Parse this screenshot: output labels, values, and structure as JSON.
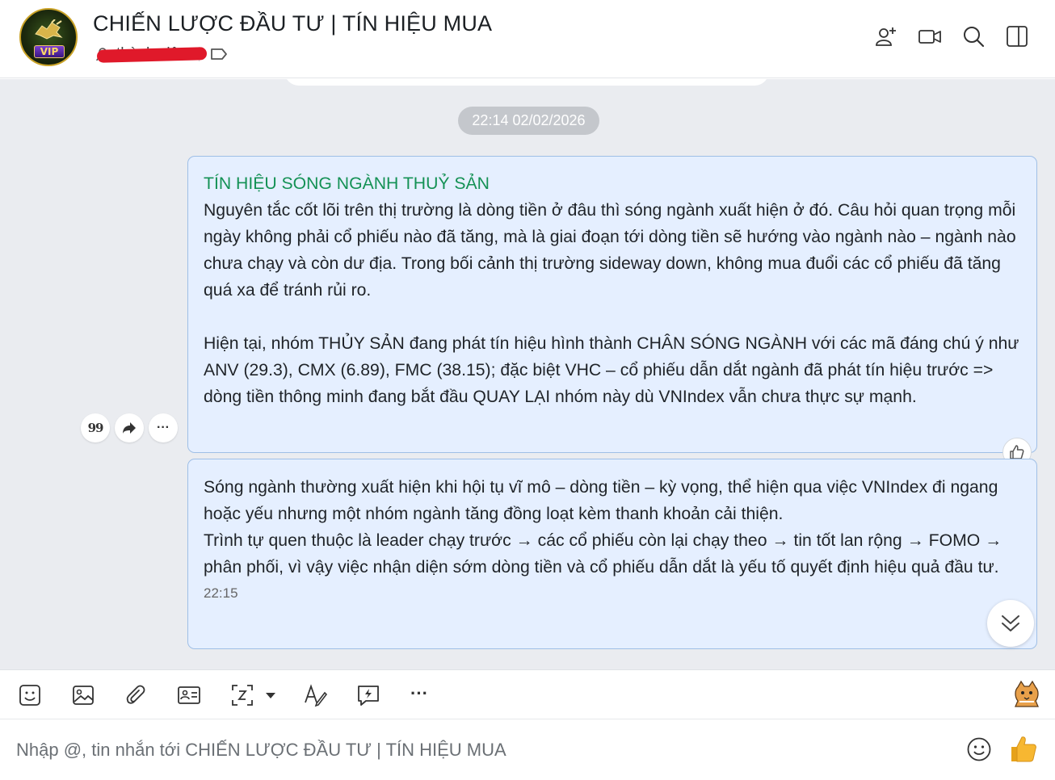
{
  "header": {
    "title": "CHIẾN LƯỢC ĐẦU TƯ | TÍN HIỆU MUA",
    "members_label": "thành viên",
    "avatar_badge": "VIP",
    "icons": [
      "add-member-icon",
      "video-call-icon",
      "search-icon",
      "sidebar-toggle-icon"
    ]
  },
  "chat": {
    "timestamp": "22:14 02/02/2026",
    "message1": {
      "heading": "TÍN HIỆU SÓNG NGÀNH THUỶ SẢN",
      "paragraph1": "Nguyên tắc cốt lõi trên thị trường là dòng tiền ở đâu thì sóng ngành xuất hiện ở đó. Câu hỏi quan trọng mỗi ngày không phải cổ phiếu nào đã tăng, mà là giai đoạn tới dòng tiền sẽ hướng vào ngành nào – ngành nào chưa chạy và còn dư địa. Trong bối cảnh thị trường sideway down, không mua đuổi các cổ phiếu đã tăng quá xa để tránh rủi ro.",
      "paragraph2": "Hiện tại, nhóm THỦY SẢN đang phát tín hiệu hình thành CHÂN SÓNG NGÀNH với các mã đáng chú ý như ANV (29.3), CMX (6.89), FMC (38.15); đặc biệt VHC – cổ phiếu dẫn dắt ngành đã phát tín hiệu trước => dòng tiền thông minh đang bắt đầu QUAY LẠI nhóm này dù VNIndex vẫn chưa thực sự mạnh."
    },
    "message2": {
      "paragraph1": "Sóng ngành thường xuất hiện khi hội tụ vĩ mô – dòng tiền – kỳ vọng, thể hiện qua việc VNIndex đi ngang hoặc yếu nhưng một nhóm ngành tăng đồng loạt kèm thanh khoản cải thiện.",
      "paragraph2": "Trình tự quen thuộc là leader chạy trước → các cổ phiếu còn lại chạy theo → tin tốt lan rộng → FOMO → phân phối, vì vậy việc nhận diện sớm dòng tiền và cổ phiếu dẫn dắt là yếu tố quyết định hiệu quả đầu tư.",
      "time": "22:15"
    },
    "message_actions": {
      "quote_glyph": "99",
      "more_glyph": "···"
    }
  },
  "toolbar": {
    "icons": [
      "sticker-icon",
      "image-icon",
      "attachment-icon",
      "contact-card-icon",
      "screenshot-icon",
      "text-format-icon",
      "quick-message-icon",
      "more-icon"
    ],
    "more_glyph": "···"
  },
  "composer": {
    "placeholder": "Nhập @, tin nhắn tới CHIẾN LƯỢC ĐẦU TƯ | TÍN HIỆU MUA",
    "value": ""
  },
  "colors": {
    "heading_green": "#149155",
    "bubble_bg": "#e5efff",
    "bubble_border": "#9fbfe6",
    "chat_bg": "#eaecf0",
    "timestamp_bg": "#c4c7cc",
    "redaction": "#e0192a"
  }
}
